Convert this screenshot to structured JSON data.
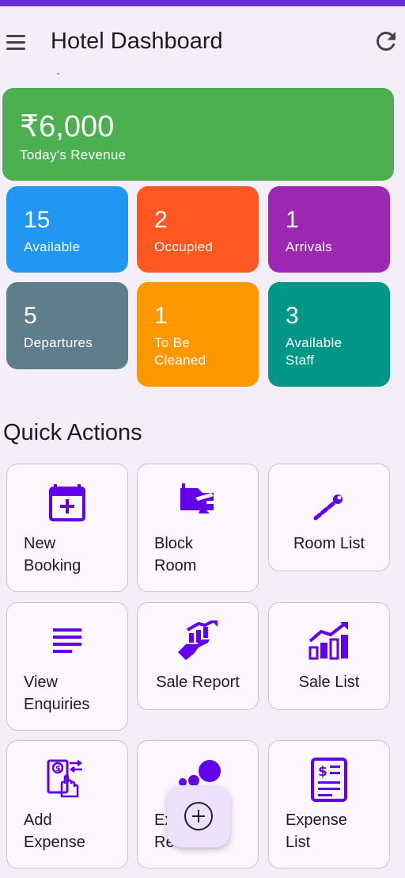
{
  "app": {
    "title": "Hotel Dashboard"
  },
  "revenue": {
    "value": "₹6,000",
    "label": "Today's Revenue",
    "color": "#4caf50"
  },
  "stats": [
    {
      "value": "15",
      "label": "Available",
      "color": "#2196f3"
    },
    {
      "value": "2",
      "label": "Occupied",
      "color": "#ff5722"
    },
    {
      "value": "1",
      "label": "Arrivals",
      "color": "#9c27b0"
    },
    {
      "value": "5",
      "label": "Departures",
      "color": "#607d8b"
    },
    {
      "value": "1",
      "label": "To Be\nCleaned",
      "color": "#ff9800"
    },
    {
      "value": "3",
      "label": "Available\nStaff",
      "color": "#009688"
    }
  ],
  "quick_actions": {
    "heading": "Quick Actions",
    "icon_color": "#6200ea",
    "items": [
      {
        "label": "New\nBooking",
        "icon": "calendar-add-icon"
      },
      {
        "label": "Block\nRoom",
        "icon": "block-room-icon"
      },
      {
        "label": "Room List",
        "icon": "wrench-icon"
      },
      {
        "label": "View\nEnquiries",
        "icon": "notes-icon"
      },
      {
        "label": "Sale Report",
        "icon": "growth-hand-icon"
      },
      {
        "label": "Sale List",
        "icon": "bar-chart-icon"
      },
      {
        "label": "Add\nExpense",
        "icon": "money-transfer-icon"
      },
      {
        "label": "Ex\nRe",
        "icon": "expense-report-icon"
      },
      {
        "label": "Expense\nList",
        "icon": "invoice-icon"
      }
    ]
  },
  "fab": {
    "icon": "add-circle-icon"
  }
}
